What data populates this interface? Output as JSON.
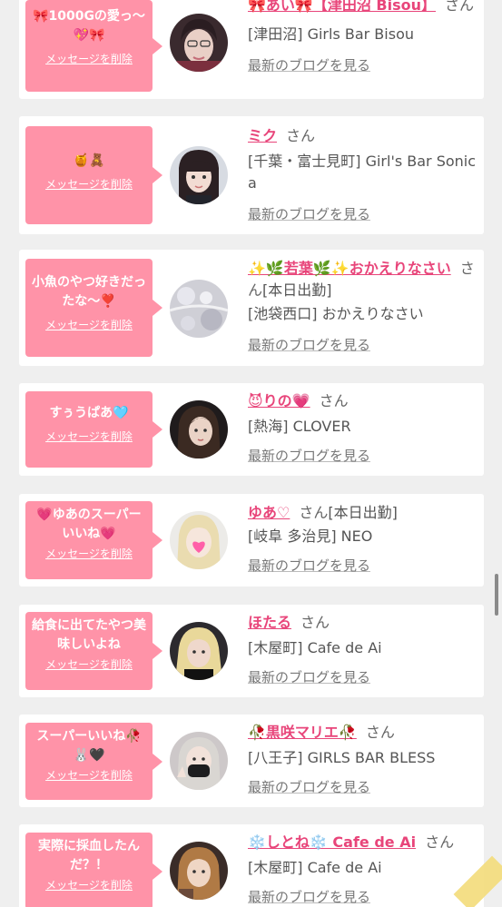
{
  "delete_label": "メッセージを削除",
  "blog_label": "最新のブログを見る",
  "honorific": "さん",
  "colors": {
    "bubble": "#ff93a8",
    "name": "#e8457a",
    "background": "#efefef"
  },
  "cards": [
    {
      "message": "🎀1000Gの愛っ〜💖🎀",
      "name": "🎀あい🎀【津田沼 Bisou】",
      "status": "",
      "shop": "[津田沼] Girls Bar Bisou",
      "avatar_icon": "profile-photo-icon"
    },
    {
      "message": "🍯🧸",
      "name": "ミク",
      "status": "",
      "shop": "[千葉・富士見町] Girl's Bar Sonica",
      "avatar_icon": "profile-photo-icon"
    },
    {
      "message": "小魚のやつ好きだったな〜❣️",
      "name": "✨🌿若葉🌿✨おかえりなさい",
      "status": "[本日出勤]",
      "shop": "[池袋西口] おかえりなさい",
      "avatar_icon": "profile-photo-icon"
    },
    {
      "message": "すぅうぱあ🩵",
      "name": "😈りの💗",
      "status": "",
      "shop": "[熱海] CLOVER",
      "avatar_icon": "profile-photo-icon"
    },
    {
      "message": "💗ゆあのスーパーいいね💗",
      "name": "ゆあ♡",
      "status": "[本日出勤]",
      "shop": "[岐阜 多治見] NEO",
      "avatar_icon": "profile-photo-icon"
    },
    {
      "message": "給食に出てたやつ美味しいよね",
      "name": "ほたる",
      "status": "",
      "shop": "[木屋町] Cafe de Ai",
      "avatar_icon": "profile-photo-icon"
    },
    {
      "message": "スーパーいいね🥀🐰🖤",
      "name": "🥀黒咲マリエ🥀",
      "status": "",
      "shop": "[八王子] GIRLS BAR BLESS",
      "avatar_icon": "profile-photo-icon"
    },
    {
      "message": "実際に採血したんだ？！",
      "name": "❄️しとね❄️ Cafe de Ai",
      "status": "",
      "shop": "[木屋町] Cafe de Ai",
      "avatar_icon": "profile-photo-icon"
    }
  ]
}
